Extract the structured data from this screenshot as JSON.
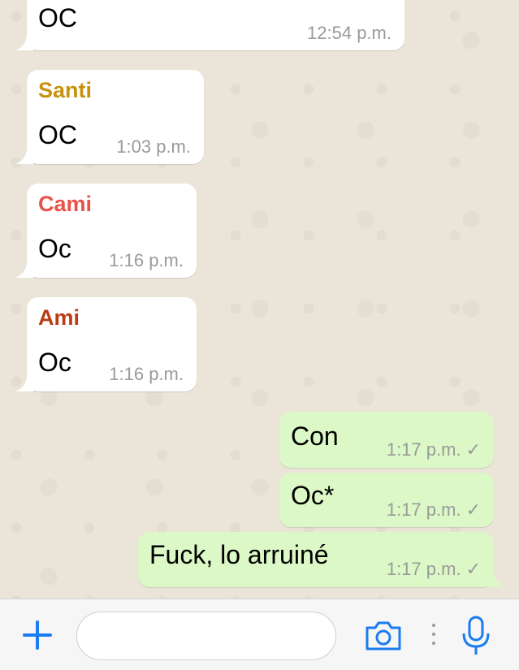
{
  "messages": [
    {
      "sender": "",
      "text": "OC",
      "time": "12:54 p.m.",
      "direction": "in"
    },
    {
      "sender": "Santi",
      "text": "OC",
      "time": "1:03 p.m.",
      "direction": "in"
    },
    {
      "sender": "Cami",
      "text": "Oc",
      "time": "1:16 p.m.",
      "direction": "in"
    },
    {
      "sender": "Ami",
      "text": "Oc",
      "time": "1:16 p.m.",
      "direction": "in"
    },
    {
      "sender": "",
      "text": "Con",
      "time": "1:17 p.m.",
      "direction": "out"
    },
    {
      "sender": "",
      "text": "Oc*",
      "time": "1:17 p.m.",
      "direction": "out"
    },
    {
      "sender": "",
      "text": "Fuck, lo arruiné",
      "time": "1:17 p.m.",
      "direction": "out"
    }
  ],
  "colors": {
    "santi": "#c8920f",
    "cami": "#e9524a",
    "ami": "#b83d16",
    "accent": "#1a7cf0",
    "incoming_bubble": "#ffffff",
    "outgoing_bubble": "#dcf8c6"
  },
  "input_bar": {
    "icons": [
      "plus-icon",
      "camera-icon",
      "more-dots-icon",
      "microphone-icon"
    ],
    "placeholder": ""
  }
}
